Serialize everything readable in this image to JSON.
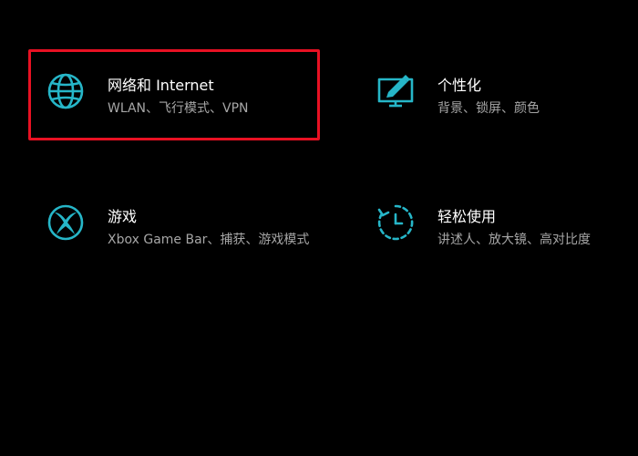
{
  "accent_color": "#26b6c8",
  "highlight_color": "#e81123",
  "tiles": [
    {
      "icon": "globe-icon",
      "title": "网络和 Internet",
      "desc": "WLAN、飞行模式、VPN"
    },
    {
      "icon": "personalization-icon",
      "title": "个性化",
      "desc": "背景、锁屏、颜色"
    },
    {
      "icon": "xbox-icon",
      "title": "游戏",
      "desc": "Xbox Game Bar、捕获、游戏模式"
    },
    {
      "icon": "ease-of-access-icon",
      "title": "轻松使用",
      "desc": "讲述人、放大镜、高对比度"
    }
  ]
}
